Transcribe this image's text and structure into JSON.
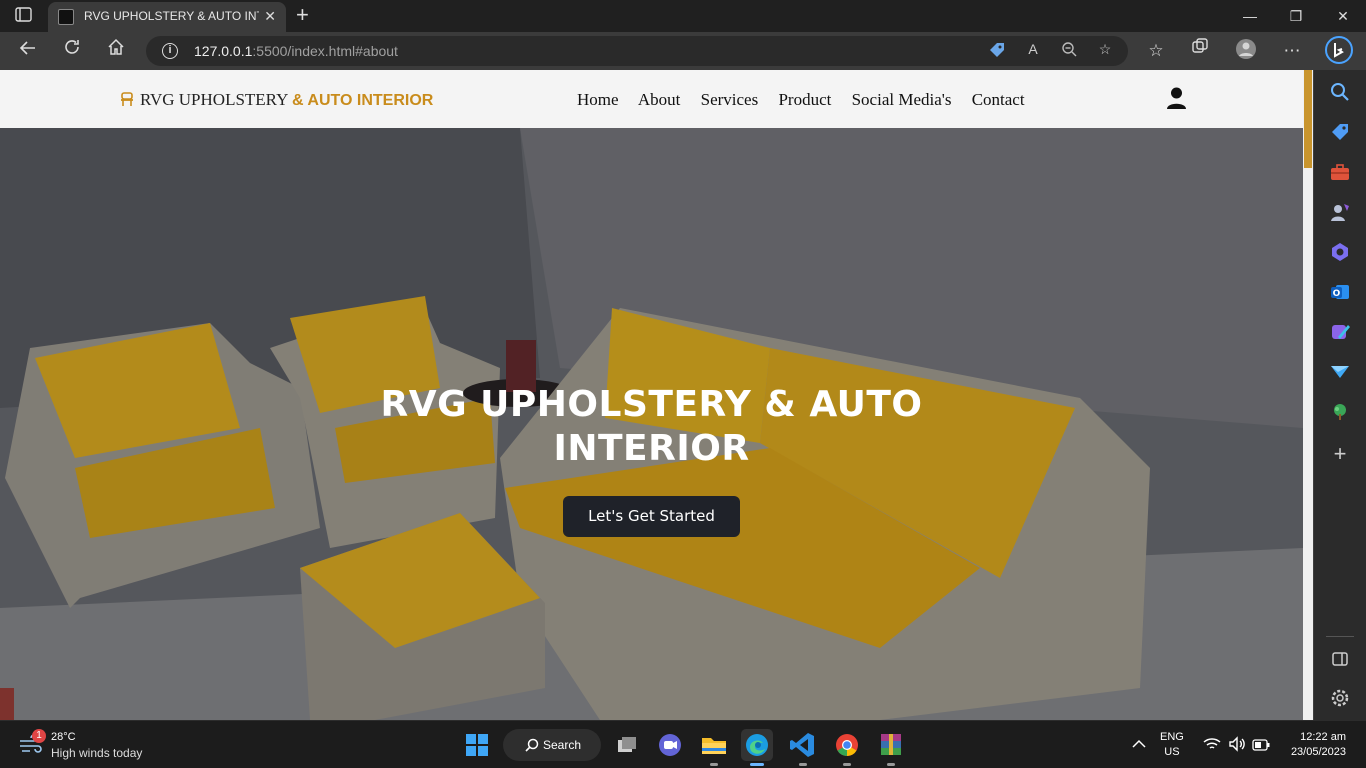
{
  "browser": {
    "tab_title": "RVG UPHOLSTERY & AUTO INTERIOR",
    "tab_close_glyph": "✕",
    "new_tab_glyph": "+",
    "url_host": "127.0.0.1",
    "url_rest": ":5500/index.html#about",
    "window_controls": {
      "minimize": "—",
      "maximize": "❐",
      "close": "✕"
    },
    "icons": [
      "tab-actions-icon",
      "back-icon",
      "refresh-icon",
      "home-icon",
      "site-info-icon",
      "tracking-tag-icon",
      "read-aloud-icon",
      "zoom-icon",
      "add-favorite-icon",
      "favorites-icon",
      "collections-icon",
      "profile-avatar-icon",
      "more-menu-icon",
      "bing-icon"
    ]
  },
  "sidebar": {
    "icons": [
      "search-icon",
      "shopping-tag-icon",
      "tools-icon",
      "games-icon",
      "office-icon",
      "outlook-icon",
      "designer-icon",
      "send-icon",
      "tree-icon",
      "add-icon",
      "split-screen-icon",
      "settings-icon"
    ],
    "add_glyph": "+"
  },
  "site": {
    "logo_main": "RVG UPHOLSTERY ",
    "logo_accent": "& AUTO INTERIOR",
    "nav": [
      "Home",
      "About",
      "Services",
      "Product",
      "Social Media's",
      "Contact"
    ],
    "user_icon": "user-icon",
    "accent_color": "#c98c1c"
  },
  "hero": {
    "title_line1": "RVG UPHOLSTERY & AUTO",
    "title_line2": "INTERIOR",
    "cta": "Let's Get Started",
    "image": "living-room-yellow-sofa"
  },
  "taskbar": {
    "weather_badge": "1",
    "temperature": "28°C",
    "weather": "High winds today",
    "search_label": "Search",
    "lang_line1": "ENG",
    "lang_line2": "US",
    "time": "12:22 am",
    "date": "23/05/2023",
    "apps": [
      "start-icon",
      "task-view-icon",
      "teams-icon",
      "file-explorer-icon",
      "edge-icon",
      "vscode-icon",
      "chrome-icon",
      "winrar-icon"
    ]
  }
}
